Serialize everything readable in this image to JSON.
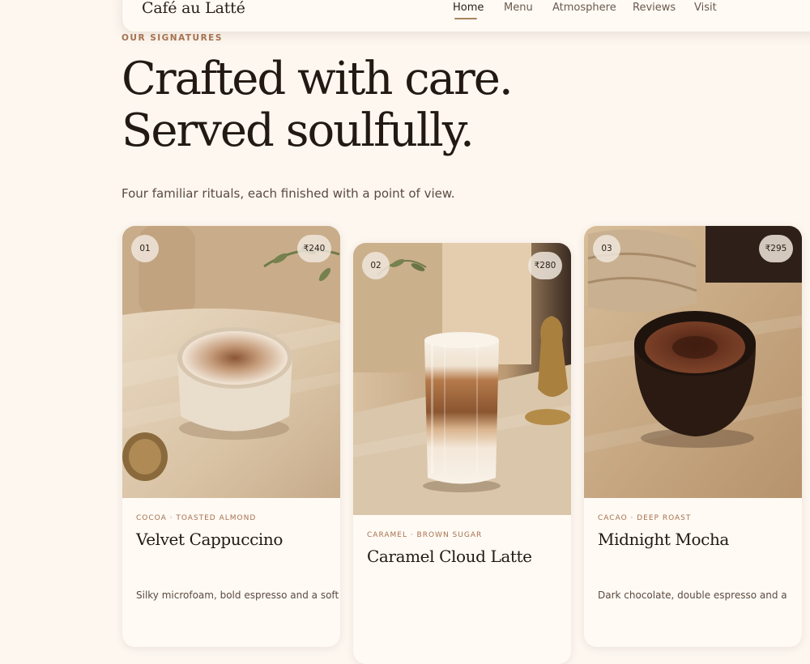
{
  "brand": {
    "name": "Café au Latté"
  },
  "nav": {
    "items": [
      {
        "label": "Home"
      },
      {
        "label": "Menu"
      },
      {
        "label": "Atmosphere"
      },
      {
        "label": "Reviews"
      },
      {
        "label": "Visit"
      }
    ],
    "active_item": "Home"
  },
  "hero": {
    "eyebrow": "OUR SIGNATURES",
    "headline_line1": "Crafted with care.",
    "headline_line2": "Served soulfully.",
    "subhead": "Four familiar rituals, each finished with a point of view."
  },
  "cards": [
    {
      "number": "01",
      "price": "₹240",
      "tags": "COCOA · TOASTED ALMOND",
      "title": "Velvet Cappuccino",
      "description": "Silky microfoam, bold espresso and a soft",
      "image": "cappuccino-cup-on-stone-table"
    },
    {
      "number": "02",
      "price": "₹280",
      "tags": "CARAMEL · BROWN SUGAR",
      "title": "Caramel Cloud Latte",
      "description": "",
      "image": "layered-latte-glass"
    },
    {
      "number": "03",
      "price": "₹295",
      "tags": "CACAO · DEEP ROAST",
      "title": "Midnight Mocha",
      "description": "Dark chocolate, double espresso and a",
      "image": "dark-mocha-cup"
    }
  ],
  "colors": {
    "background": "#fdf7f0",
    "accent": "#a6714f",
    "text": "#231913"
  }
}
